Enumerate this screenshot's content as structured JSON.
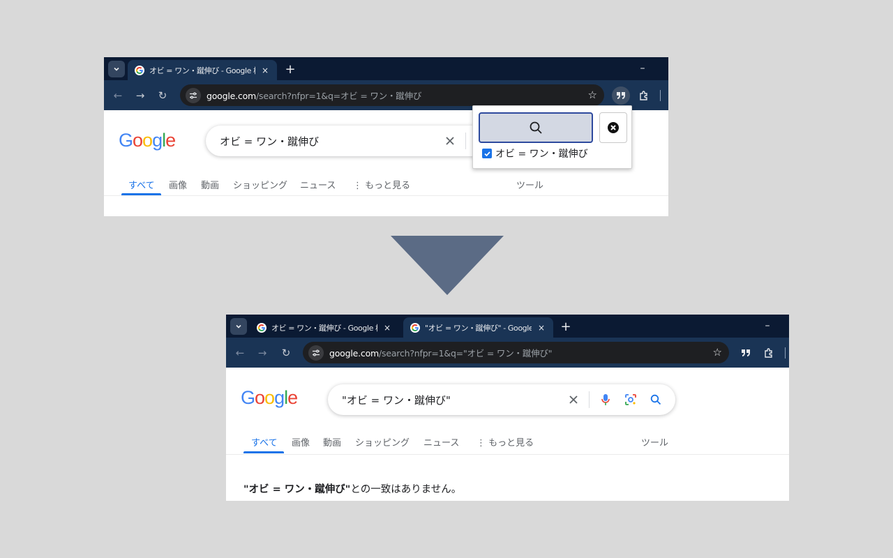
{
  "top": {
    "tab": {
      "title": "オビ = ワン・蹴伸び - Google 検索",
      "close": "×"
    },
    "newtab": "+",
    "minimize": "–",
    "url_host": "google.com",
    "url_path": "/search?nfpr=1&q=オビ = ワン・蹴伸び",
    "logo": "Google",
    "query": "オビ = ワン・蹴伸び",
    "nav": [
      "すべて",
      "画像",
      "動画",
      "ショッピング",
      "ニュース",
      "もっと見る"
    ],
    "tools": "ツール",
    "popup": {
      "checkbox_label": "オビ = ワン・蹴伸び",
      "checked": true
    }
  },
  "bottom": {
    "tab1": {
      "title": "オビ = ワン・蹴伸び - Google 検索",
      "close": "×"
    },
    "tab2": {
      "title": "\"オビ = ワン・蹴伸び\" - Google 検索",
      "close": "×"
    },
    "newtab": "+",
    "minimize": "–",
    "url_host": "google.com",
    "url_path": "/search?nfpr=1&q=\"オビ = ワン・蹴伸び\"",
    "logo": "Google",
    "query": "\"オビ = ワン・蹴伸び\"",
    "nav": [
      "すべて",
      "画像",
      "動画",
      "ショッピング",
      "ニュース",
      "もっと見る"
    ],
    "tools": "ツール",
    "result_query": "\"オビ = ワン・蹴伸び\"",
    "result_suffix": "との一致はありません。"
  },
  "colors": {
    "tabstrip": "#0b1a33",
    "toolbar": "#1a3455",
    "link_blue": "#1a73e8",
    "arrow": "#5b6b85"
  }
}
